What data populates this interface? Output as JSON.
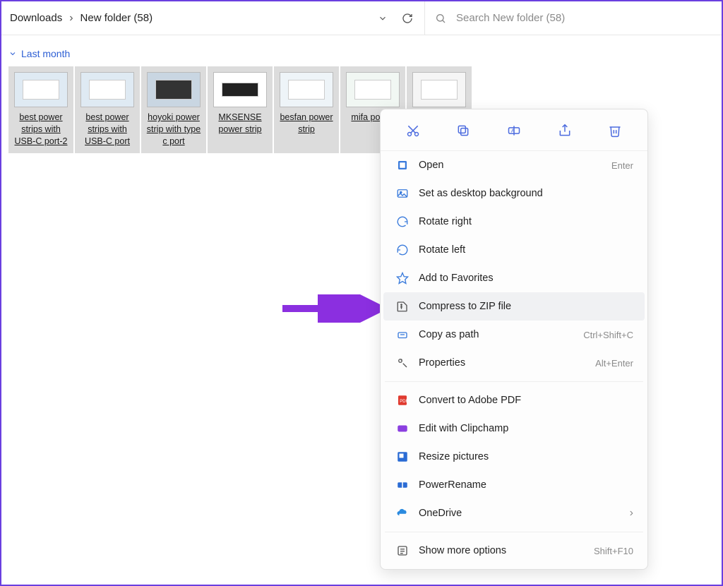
{
  "breadcrumb": {
    "root": "Downloads",
    "current": "New folder (58)"
  },
  "search": {
    "placeholder": "Search New folder (58)"
  },
  "group": {
    "label": "Last month"
  },
  "files": [
    {
      "name": "best power strips with USB-C port-2",
      "selected": true
    },
    {
      "name": "best power strips with USB-C port",
      "selected": true
    },
    {
      "name": "hoyoki power strip with type c port",
      "selected": true
    },
    {
      "name": "MKSENSE power strip",
      "selected": true
    },
    {
      "name": "besfan power strip",
      "selected": true
    },
    {
      "name": "mifa power",
      "selected": true
    },
    {
      "name": "",
      "selected": true
    }
  ],
  "context_toolbar": [
    "cut",
    "copy",
    "rename",
    "share",
    "delete"
  ],
  "context_menu": {
    "group1": [
      {
        "icon": "open",
        "label": "Open",
        "accel": "Enter",
        "hover": false
      },
      {
        "icon": "wallpaper",
        "label": "Set as desktop background",
        "accel": "",
        "hover": false
      },
      {
        "icon": "rotate-r",
        "label": "Rotate right",
        "accel": "",
        "hover": false
      },
      {
        "icon": "rotate-l",
        "label": "Rotate left",
        "accel": "",
        "hover": false
      },
      {
        "icon": "star",
        "label": "Add to Favorites",
        "accel": "",
        "hover": false
      },
      {
        "icon": "zip",
        "label": "Compress to ZIP file",
        "accel": "",
        "hover": true
      },
      {
        "icon": "copypath",
        "label": "Copy as path",
        "accel": "Ctrl+Shift+C",
        "hover": false
      },
      {
        "icon": "props",
        "label": "Properties",
        "accel": "Alt+Enter",
        "hover": false
      }
    ],
    "group2": [
      {
        "icon": "pdf",
        "label": "Convert to Adobe PDF"
      },
      {
        "icon": "clipchamp",
        "label": "Edit with Clipchamp"
      },
      {
        "icon": "resize",
        "label": "Resize pictures"
      },
      {
        "icon": "rename2",
        "label": "PowerRename"
      },
      {
        "icon": "onedrive",
        "label": "OneDrive",
        "submenu": true
      }
    ],
    "group3": [
      {
        "icon": "more",
        "label": "Show more options",
        "accel": "Shift+F10"
      }
    ]
  }
}
